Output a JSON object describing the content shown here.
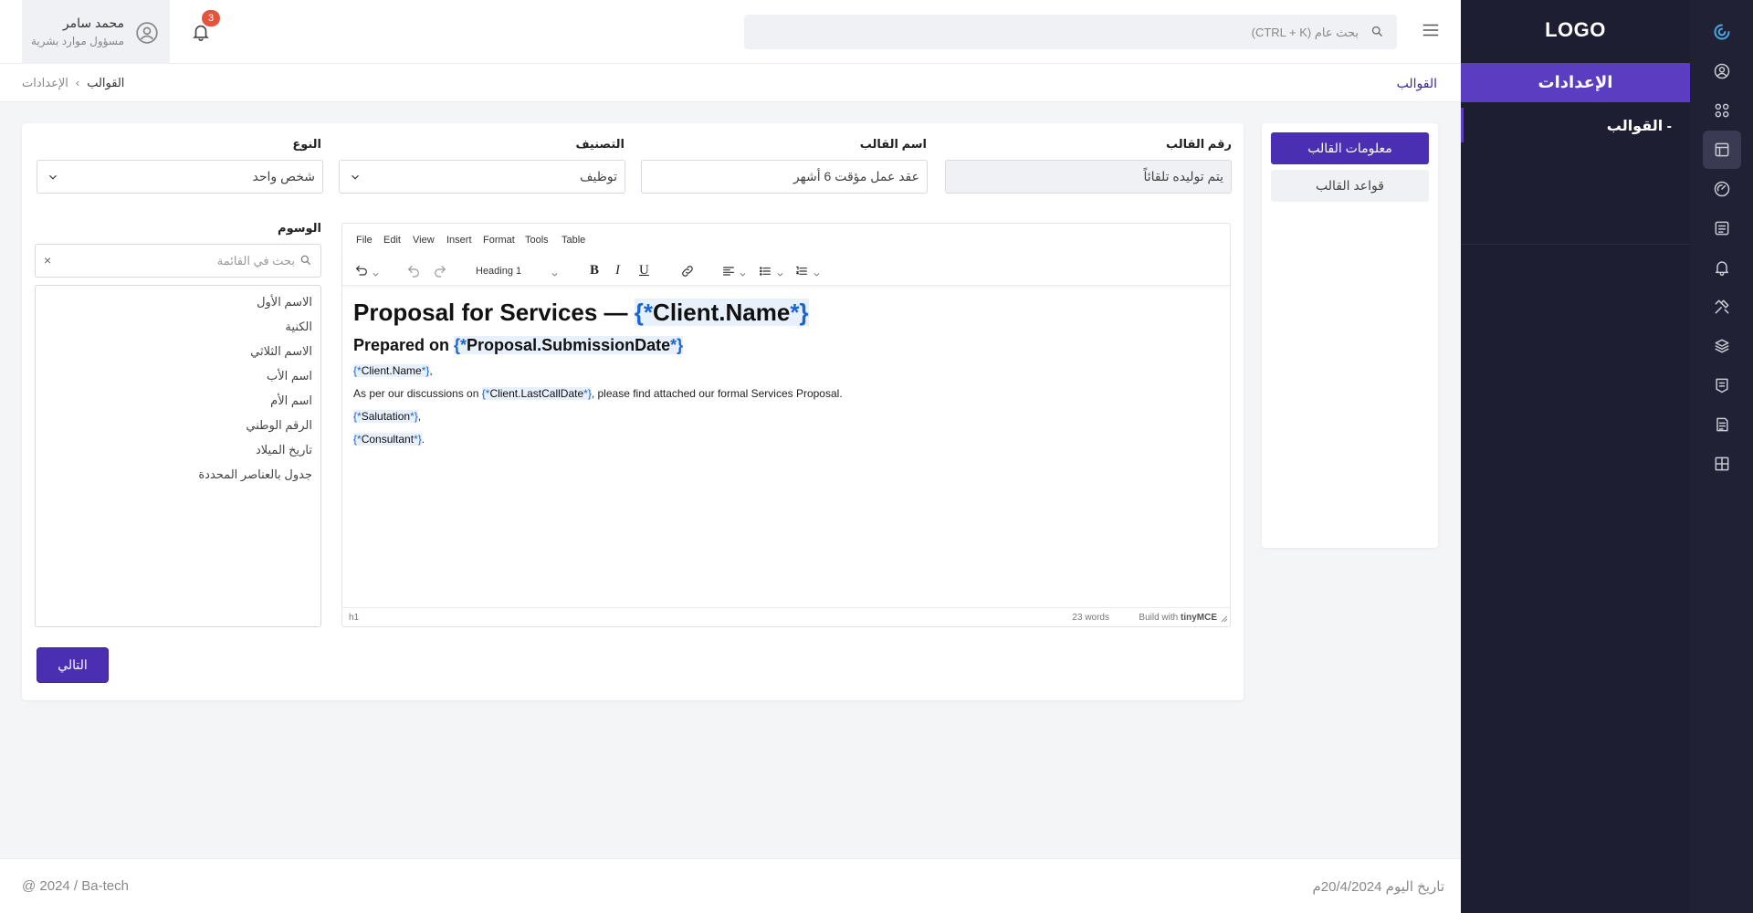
{
  "sidebar": {
    "logo": "LOGO",
    "active_section": "الإعدادات",
    "sub_item": "- القوالب"
  },
  "rail": {
    "icons": [
      "logo-mark-icon",
      "user-circle-icon",
      "apps-icon",
      "layout-icon",
      "gauge-icon",
      "list-icon",
      "bell-icon",
      "tools-icon",
      "layers-icon",
      "badge-icon",
      "report-icon",
      "grid-icon"
    ],
    "active_index": 3
  },
  "topbar": {
    "search_placeholder": "بحث عام (CTRL + K)",
    "notifications_count": "3",
    "user_name": "محمد سامر",
    "user_role": "مسؤول موارد بشرية"
  },
  "breadcrumb": {
    "title": "القوالب",
    "current": "القوالب",
    "separator": "›",
    "parent": "الإعدادات"
  },
  "tabs": {
    "info": "معلومات القالب",
    "rules": "قواعد القالب"
  },
  "form": {
    "template_number": {
      "label": "رقم القالب",
      "value": "يتم توليده تلقائاً"
    },
    "template_name": {
      "label": "اسم القالب",
      "value": "عقد عمل مؤقت 6 أشهر"
    },
    "category": {
      "label": "التصنيف",
      "value": "توظيف"
    },
    "type": {
      "label": "النوع",
      "value": "شخص واحد"
    },
    "next_button": "التالي"
  },
  "tags": {
    "label": "الوسوم",
    "search_placeholder": "بحث في القائمة",
    "clear": "×",
    "items": [
      "الاسم الأول",
      "الكنية",
      "الاسم الثلاثي",
      "اسم الأب",
      "اسم الأم",
      "الرقم الوطني",
      "تاريخ الميلاد",
      "جدول بالعناصر المحددة"
    ]
  },
  "editor": {
    "menu": [
      "File",
      "Edit",
      "View",
      "Insert",
      "Format",
      "Tools",
      "Table"
    ],
    "block_format": "Heading 1",
    "toolbar_text": {
      "bold": "B",
      "italic": "I",
      "underline": "U"
    },
    "heading1": {
      "prefix": "Proposal for Services — ",
      "open": "{*",
      "var": "Client.Name",
      "close": "*}"
    },
    "heading2": {
      "prefix": "Prepared on ",
      "open": "{*",
      "var": "Proposal.SubmissionDate",
      "close": "*}"
    },
    "para1": {
      "open": "{*",
      "var": "Client.Name",
      "close": "*}",
      "suffix": ","
    },
    "para2": {
      "prefix": "As per our discussions on ",
      "open": "{*",
      "var": "Client.LastCallDate",
      "close": "*}",
      "suffix": ", please find attached our formal Services Proposal."
    },
    "para3": {
      "open": "{*",
      "var": "Salutation",
      "close": "*}",
      "suffix": ","
    },
    "para4": {
      "open": "{*",
      "var": "Consultant",
      "close": "*}",
      "suffix": "."
    },
    "status_path": "h1",
    "word_count": "23 words",
    "brand_prefix": "Build with ",
    "brand_name": "tinyMCE"
  },
  "footer": {
    "date": "تاريخ اليوم 20/4/2024م",
    "copyright": "@ 2024 / Ba-tech"
  }
}
